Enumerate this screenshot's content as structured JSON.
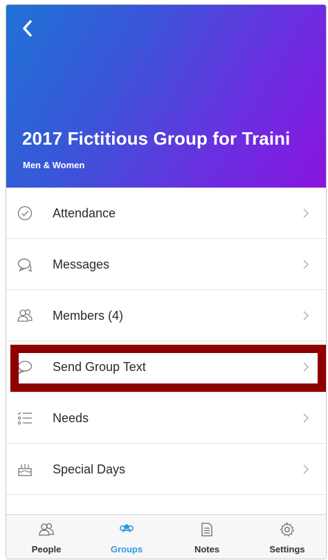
{
  "header": {
    "title": "2017 Fictitious Group for Traini",
    "subtitle": "Men & Women"
  },
  "menu": {
    "items": [
      {
        "label": "Attendance",
        "icon": "check-circle-icon"
      },
      {
        "label": "Messages",
        "icon": "chat-bubbles-icon"
      },
      {
        "label": "Members (4)",
        "icon": "members-icon"
      },
      {
        "label": "Send Group Text",
        "icon": "speech-bubble-icon"
      },
      {
        "label": "Needs",
        "icon": "list-icon"
      },
      {
        "label": "Special Days",
        "icon": "cake-icon"
      }
    ]
  },
  "tabs": [
    {
      "label": "People",
      "icon": "people-icon"
    },
    {
      "label": "Groups",
      "icon": "groups-icon",
      "active": true
    },
    {
      "label": "Notes",
      "icon": "notes-icon"
    },
    {
      "label": "Settings",
      "icon": "settings-gear-icon"
    }
  ],
  "colors": {
    "accent": "#2a9be0",
    "highlight": "#8e0000",
    "gradient_start": "#1f73d6",
    "gradient_end": "#8a14e0"
  }
}
